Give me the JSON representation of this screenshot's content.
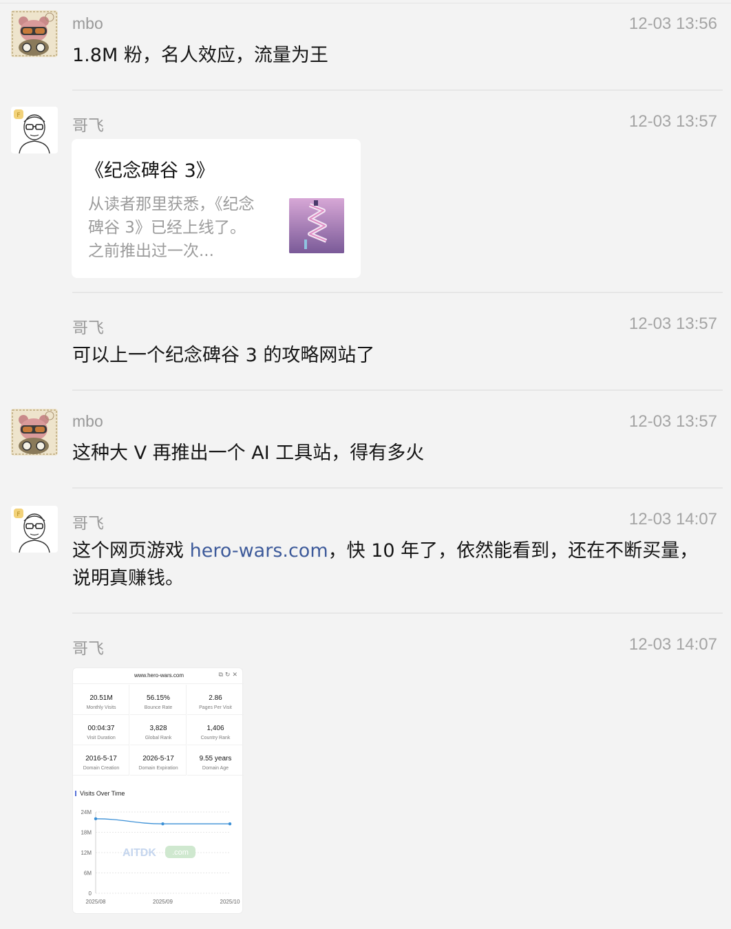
{
  "messages": [
    {
      "name": "mbo",
      "time": "12-03 13:56",
      "text": "1.8M 粉，名人效应，流量为王",
      "avatar": "bear-avatar"
    },
    {
      "name": "哥飞",
      "time": "12-03 13:57",
      "avatar": "glasses-man-avatar",
      "card": {
        "title": "《纪念碑谷 3》",
        "description": "从读者那里获悉，《纪念碑谷 3》已经上线了。之前推出过一次...",
        "thumb": "game-thumbnail"
      }
    },
    {
      "name": "哥飞",
      "time": "12-03 13:57",
      "text": "可以上一个纪念碑谷 3 的攻略网站了"
    },
    {
      "name": "mbo",
      "time": "12-03 13:57",
      "text": "这种大 V 再推出一个 AI 工具站，得有多火",
      "avatar": "bear-avatar"
    },
    {
      "name": "哥飞",
      "time": "12-03 14:07",
      "avatar": "glasses-man-avatar",
      "text_before": "这个网页游戏 ",
      "link": "hero-wars.com",
      "text_after": "，快 10 年了，依然能看到，还在不断买量，说明真赚钱。"
    },
    {
      "name": "哥飞",
      "time": "12-03 14:07"
    }
  ],
  "screenshot": {
    "domain": "www.hero-wars.com",
    "icons": [
      "share-icon",
      "refresh-icon",
      "close-icon"
    ],
    "stats": [
      {
        "value": "20.51M",
        "label": "Monthly Visits"
      },
      {
        "value": "56.15%",
        "label": "Bounce Rate"
      },
      {
        "value": "2.86",
        "label": "Pages Per Visit"
      },
      {
        "value": "00:04:37",
        "label": "Visit Duration"
      },
      {
        "value": "3,828",
        "label": "Global Rank"
      },
      {
        "value": "1,406",
        "label": "Country Rank"
      },
      {
        "value": "2016-5-17",
        "label": "Domain Creation"
      },
      {
        "value": "2026-5-17",
        "label": "Domain Expiration"
      },
      {
        "value": "9.55 years",
        "label": "Domain Age"
      }
    ],
    "watermark": "AITDK",
    "watermark_suffix": ".com"
  },
  "chart_data": {
    "type": "line",
    "title": "Visits Over Time",
    "categories": [
      "2025/08",
      "2025/09",
      "2025/10"
    ],
    "series": [
      {
        "values": [
          22.0,
          20.5,
          20.5
        ]
      }
    ],
    "yticks": [
      "0",
      "6M",
      "12M",
      "18M",
      "24M"
    ],
    "ylim": [
      0,
      24
    ],
    "grid": true,
    "color": "#3a8fd6"
  }
}
